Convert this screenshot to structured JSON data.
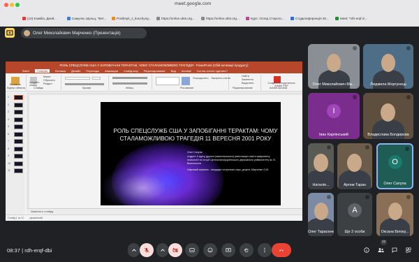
{
  "browser": {
    "url": "meet.google.com",
    "tabs": [
      {
        "label": "(10) Езикіliа, Денй...",
        "color": "#e03b3b"
      },
      {
        "label": "Самуэль Шульц, \"Вет...",
        "color": "#3f7ddd"
      },
      {
        "label": "Posibnyk_z_kouchyng...",
        "color": "#e98b2a"
      },
      {
        "label": "https://online.ubts.org...",
        "color": "#888888"
      },
      {
        "label": "https://online.ubts.org...",
        "color": "#888888"
      },
      {
        "label": "Курс: Огляд Старого...",
        "color": "#b44b8f"
      },
      {
        "label": "Студконференція 20...",
        "color": "#2d6fd1"
      },
      {
        "label": "Meet: \"rdh-erqf-d...",
        "color": "#2a8a3c"
      }
    ]
  },
  "meet": {
    "presenter_label": "Олег Миколайович Марченко (Презентація)",
    "meeting_time": "08:37",
    "meeting_code": "rdh-erqf-dbi",
    "participant_count": "12",
    "accent_color": "#ea4335"
  },
  "powerpoint": {
    "title_bar": "РОЛЬ СПЕЦСЛУЖБ США У ЗАПОБІГАННІ ТЕРАКТАМ, ЧОМУ СТАЛАМОЖЛИВОЮ ТРАГЕДІЯ - PowerPoint (Сбій активації продукту)",
    "menu": [
      "Файл",
      "Главная",
      "Вставка",
      "Дизайн",
      "Переходы",
      "Анимация",
      "Слайд-шоу",
      "Рецензирование",
      "Вид",
      "Acrobat",
      "Что вы хотите сделать?"
    ],
    "ribbon_groups": [
      "Буфер обмена",
      "Слайды",
      "Шрифт",
      "Абзац",
      "Рисование",
      "Редактирование",
      "Adobe Acrobat"
    ],
    "ribbon_labels": [
      "Вставить",
      "Создать слайд",
      "Макет",
      "Сбросить",
      "Раздел",
      "Упорядочить",
      "Экспресс-стили",
      "Найти",
      "Заменить",
      "Выделить",
      "Создать и поделиться Adobe PDF"
    ],
    "thumb_numbers": [
      "1",
      "2",
      "3",
      "4",
      "5",
      "6",
      "7",
      "8",
      "9",
      "10",
      "11"
    ],
    "slide_title": "РОЛЬ СПЕЦСЛУЖБ США У ЗАПОБІГАННІ ТЕРАКТАМ: ЧОМУ СТАЛАМОЖЛИВОЮ ТРАГЕДІЯ 11 ВЕРЕСНЯ 2001 РОКУ",
    "slide_author": "Олег Сапула",
    "slide_author_info": "студент ІІ курсу другого (магістерського) рівня вищої освіти факультету психології та історії Центральноукраїнського державного університету ім. В. Винниченка",
    "slide_supervisor": "Науковий керівник - кандидат історичних наук, доцент, Марченко О.М.",
    "notes_placeholder": "Заметки к слайду",
    "status_slide": "Слайд 1 из 11",
    "status_lang": "украинский"
  },
  "participants": [
    {
      "name": "Олег Миколайович Ма...",
      "kind": "photo",
      "bg": "#8a8f96"
    },
    {
      "name": "Людмила Моргунець",
      "kind": "photo",
      "bg": "#4d6e86"
    },
    {
      "name": "Іван Карпінський",
      "kind": "letter",
      "letter": "І",
      "bg": "#7b2d8e",
      "circle": "#a046b8"
    },
    {
      "name": "Владислава Болдирєва",
      "kind": "photo",
      "bg": "#5e4e3d"
    },
    {
      "name": "Наталія...",
      "kind": "photo",
      "bg": "#5a5a55"
    },
    {
      "name": "Артем Таран",
      "kind": "photo",
      "bg": "#6b5d4a"
    },
    {
      "name": "Олег Сапула",
      "kind": "letter",
      "letter": "О",
      "bg": "#1e5c54",
      "circle": "#1a7a6e"
    },
    {
      "name": "Олег Тарасенко",
      "kind": "photo",
      "bg": "#7b8ba6"
    },
    {
      "name": "Ще 2 особи",
      "kind": "others",
      "letter": "A",
      "bg": "#3c4043"
    },
    {
      "name": "Оксана Білоку...",
      "kind": "photo",
      "bg": "#8a6f57"
    }
  ]
}
